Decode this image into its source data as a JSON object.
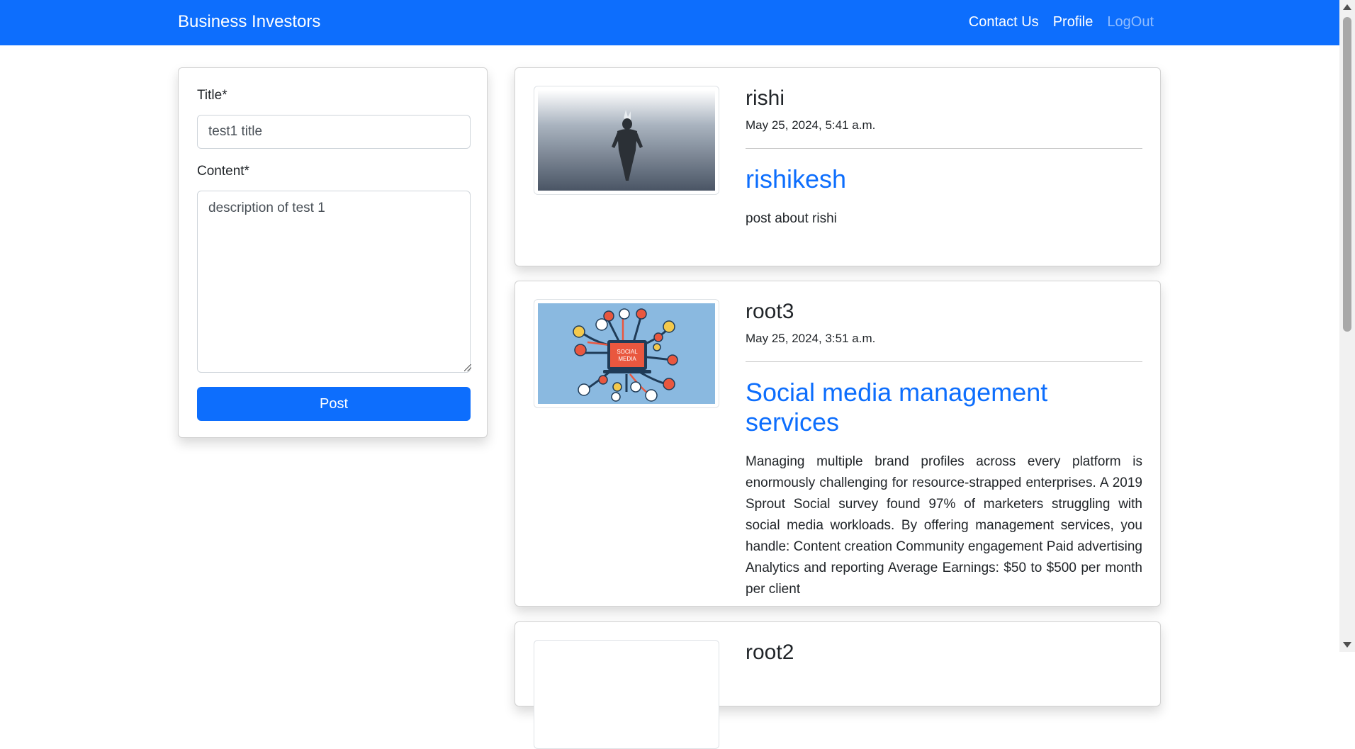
{
  "navbar": {
    "brand": "Business Investors",
    "links": [
      "Contact Us",
      "Profile",
      "LogOut"
    ]
  },
  "form": {
    "title_label": "Title*",
    "title_value": "test1 title",
    "content_label": "Content*",
    "content_value": "description of test 1",
    "submit_label": "Post"
  },
  "posts": [
    {
      "author": "rishi",
      "date": "May 25, 2024, 5:41 a.m.",
      "title": "rishikesh",
      "content": "post about rishi",
      "image": "warrior-in-fog-image"
    },
    {
      "author": "root3",
      "date": "May 25, 2024, 3:51 a.m.",
      "title": "Social media management services",
      "content": "Managing multiple brand profiles across every platform is enormously challenging for resource-strapped enterprises. A 2019 Sprout Social survey found 97% of marketers struggling with social media workloads. By offering management services, you handle: Content creation Community engagement Paid advertising Analytics and reporting Average Earnings: $50 to $500 per month per client",
      "image": "social-media-illustration",
      "image_caption": "SOCIAL MEDIA"
    },
    {
      "author": "root2"
    }
  ],
  "colors": {
    "primary": "#0d6efd",
    "text": "#212529"
  }
}
